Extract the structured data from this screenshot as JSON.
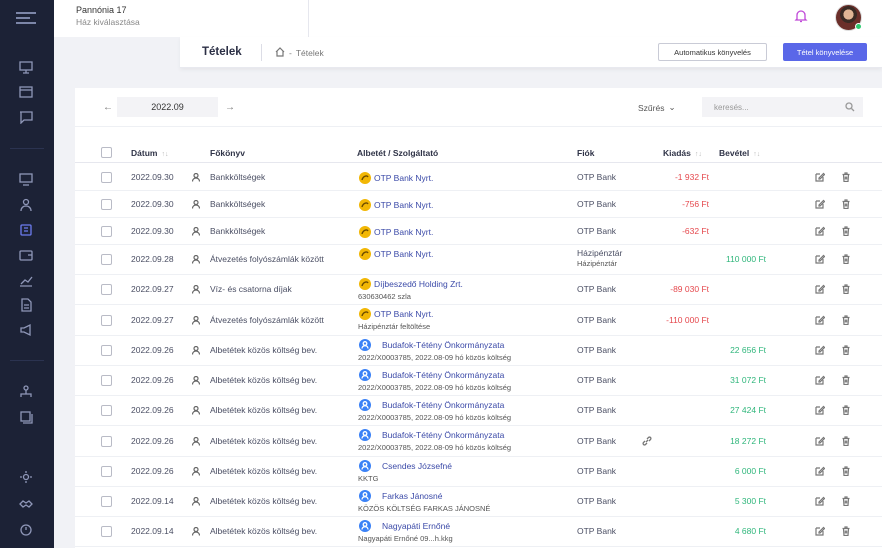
{
  "header": {
    "project_name": "Pannónia 17",
    "project_sub": "Ház kiválasztása"
  },
  "subheader": {
    "title": "Tételek",
    "breadcrumb": "Tételek",
    "auto_button": "Automatikus könyvelés",
    "book_button": "Tétel könyvelése"
  },
  "toolbar": {
    "period": "2022.09",
    "prev": "←",
    "next": "→",
    "filter_label": "Szűrés",
    "search_placeholder": "keresés..."
  },
  "table": {
    "columns": {
      "date": "Dátum",
      "ledger": "Főkönyv",
      "party": "Albetét / Szolgáltató",
      "account": "Fiók",
      "expense": "Kiadás",
      "income": "Bevétel"
    },
    "rows": [
      {
        "date": "2022.09.30",
        "ledger": "Bankköltségek",
        "party": "OTP Bank Nyrt.",
        "party_sub": "",
        "icon": "otp",
        "account": "OTP Bank",
        "account_sub": "",
        "expense": "-1 932 Ft",
        "income": "",
        "linked": false
      },
      {
        "date": "2022.09.30",
        "ledger": "Bankköltségek",
        "party": "OTP Bank Nyrt.",
        "party_sub": "",
        "icon": "otp",
        "account": "OTP Bank",
        "account_sub": "",
        "expense": "-756 Ft",
        "income": "",
        "linked": false
      },
      {
        "date": "2022.09.30",
        "ledger": "Bankköltségek",
        "party": "OTP Bank Nyrt.",
        "party_sub": "",
        "icon": "otp",
        "account": "OTP Bank",
        "account_sub": "",
        "expense": "-632 Ft",
        "income": "",
        "linked": false
      },
      {
        "date": "2022.09.28",
        "ledger": "Átvezetés folyószámlák között",
        "party": "OTP Bank Nyrt.",
        "party_sub": "",
        "icon": "otp",
        "account": "Házipénztár",
        "account_sub": "Házipénztár",
        "expense": "",
        "income": "110 000 Ft",
        "linked": false
      },
      {
        "date": "2022.09.27",
        "ledger": "Víz- és csatorna díjak",
        "party": "Díjbeszedő Holding Zrt.",
        "party_sub": "630630462 szla",
        "icon": "otp",
        "account": "OTP Bank",
        "account_sub": "",
        "expense": "-89 030 Ft",
        "income": "",
        "linked": false
      },
      {
        "date": "2022.09.27",
        "ledger": "Átvezetés folyószámlák között",
        "party": "OTP Bank Nyrt.",
        "party_sub": "Házipénztár feltöltése",
        "icon": "otp",
        "account": "OTP Bank",
        "account_sub": "",
        "expense": "-110 000 Ft",
        "income": "",
        "linked": false
      },
      {
        "date": "2022.09.26",
        "ledger": "Albetétek közös költség bev.",
        "party": "Budafok-Tétény Önkormányzata",
        "party_sub": "2022/X0003785, 2022.08-09 hó közös költség",
        "icon": "usr",
        "account": "OTP Bank",
        "account_sub": "",
        "expense": "",
        "income": "22 656 Ft",
        "linked": false
      },
      {
        "date": "2022.09.26",
        "ledger": "Albetétek közös költség bev.",
        "party": "Budafok-Tétény Önkormányzata",
        "party_sub": "2022/X0003785, 2022.08-09 hó közös költség",
        "icon": "usr",
        "account": "OTP Bank",
        "account_sub": "",
        "expense": "",
        "income": "31 072 Ft",
        "linked": false
      },
      {
        "date": "2022.09.26",
        "ledger": "Albetétek közös költség bev.",
        "party": "Budafok-Tétény Önkormányzata",
        "party_sub": "2022/X0003785, 2022.08-09 hó közös költség",
        "icon": "usr",
        "account": "OTP Bank",
        "account_sub": "",
        "expense": "",
        "income": "27 424 Ft",
        "linked": false
      },
      {
        "date": "2022.09.26",
        "ledger": "Albetétek közös költség bev.",
        "party": "Budafok-Tétény Önkormányzata",
        "party_sub": "2022/X0003785, 2022.08-09 hó közös költség",
        "icon": "usr",
        "account": "OTP Bank",
        "account_sub": "",
        "expense": "",
        "income": "18 272 Ft",
        "linked": true
      },
      {
        "date": "2022.09.26",
        "ledger": "Albetétek közös költség bev.",
        "party": "Csendes Józsefné",
        "party_sub": "KKTG",
        "icon": "usr",
        "account": "OTP Bank",
        "account_sub": "",
        "expense": "",
        "income": "6 000 Ft",
        "linked": false
      },
      {
        "date": "2022.09.14",
        "ledger": "Albetétek közös költség bev.",
        "party": "Farkas Jánosné",
        "party_sub": "KÖZÖS KÖLTSÉG FARKAS JÁNOSNÉ",
        "icon": "usr",
        "account": "OTP Bank",
        "account_sub": "",
        "expense": "",
        "income": "5 300 Ft",
        "linked": false
      },
      {
        "date": "2022.09.14",
        "ledger": "Albetétek közös költség bev.",
        "party": "Nagyapáti Ernőné",
        "party_sub": "Nagyapáti Ernőné 09...h.kkg",
        "icon": "usr",
        "account": "OTP Bank",
        "account_sub": "",
        "expense": "",
        "income": "4 680 Ft",
        "linked": false
      }
    ]
  }
}
